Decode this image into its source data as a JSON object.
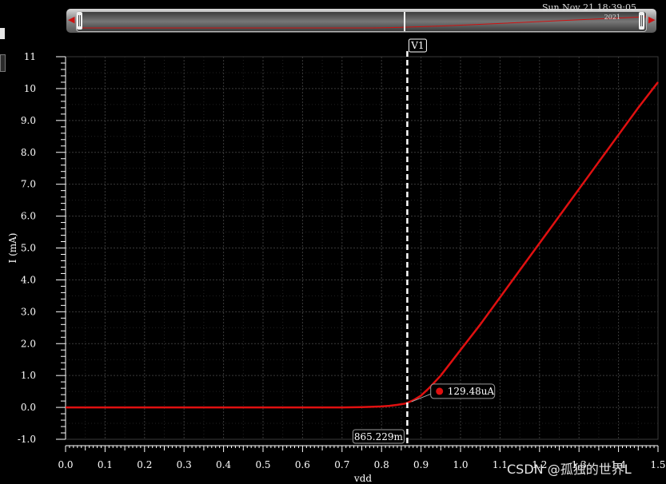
{
  "overview": {
    "title": "Sun Nov 21 18:39:05",
    "title2": "2021",
    "left_arrow_icon": "triangle-left-icon",
    "right_arrow_icon": "triangle-right-icon"
  },
  "watermark": "CSDN @孤独的世界L",
  "colors": {
    "background": "#000000",
    "curve": "#e01010",
    "axis": "#ffffff",
    "grid": "#3a3a3a",
    "marker": "#ffffff"
  },
  "chart_data": {
    "type": "line",
    "xlabel": "vdd",
    "ylabel": "I (mA)",
    "xlim": [
      0.0,
      1.5
    ],
    "ylim": [
      -1.0,
      11.0
    ],
    "grid": true,
    "x_ticks": [
      "0.0",
      "0.1",
      "0.2",
      "0.3",
      "0.4",
      "0.5",
      "0.6",
      "0.7",
      "0.8",
      "0.9",
      "1.0",
      "1.1",
      "1.2",
      "1.3",
      "1.4",
      "1.5"
    ],
    "y_ticks": [
      "-1.0",
      "0.0",
      "1.0",
      "2.0",
      "3.0",
      "4.0",
      "5.0",
      "6.0",
      "7.0",
      "8.0",
      "9.0",
      "10",
      "11"
    ],
    "series": [
      {
        "x": [
          0.0,
          0.1,
          0.2,
          0.3,
          0.4,
          0.5,
          0.6,
          0.7,
          0.75,
          0.78,
          0.8,
          0.82,
          0.84,
          0.86,
          0.88,
          0.9,
          0.92,
          0.95,
          1.0,
          1.05,
          1.1,
          1.15,
          1.2,
          1.25,
          1.3,
          1.35,
          1.4,
          1.45,
          1.5
        ],
        "y": [
          0.0,
          0.0,
          0.0,
          0.0,
          0.0,
          0.0,
          0.0,
          0.0,
          0.01,
          0.02,
          0.03,
          0.05,
          0.08,
          0.12,
          0.22,
          0.37,
          0.6,
          1.0,
          1.8,
          2.6,
          3.45,
          4.3,
          5.15,
          6.0,
          6.85,
          7.7,
          8.55,
          9.4,
          10.2
        ]
      }
    ],
    "marker": {
      "name": "V1",
      "x": 0.865229,
      "x_label": "865.229m",
      "point_x": 0.88,
      "point_y": 0.12948,
      "point_label": "129.48uA"
    }
  }
}
